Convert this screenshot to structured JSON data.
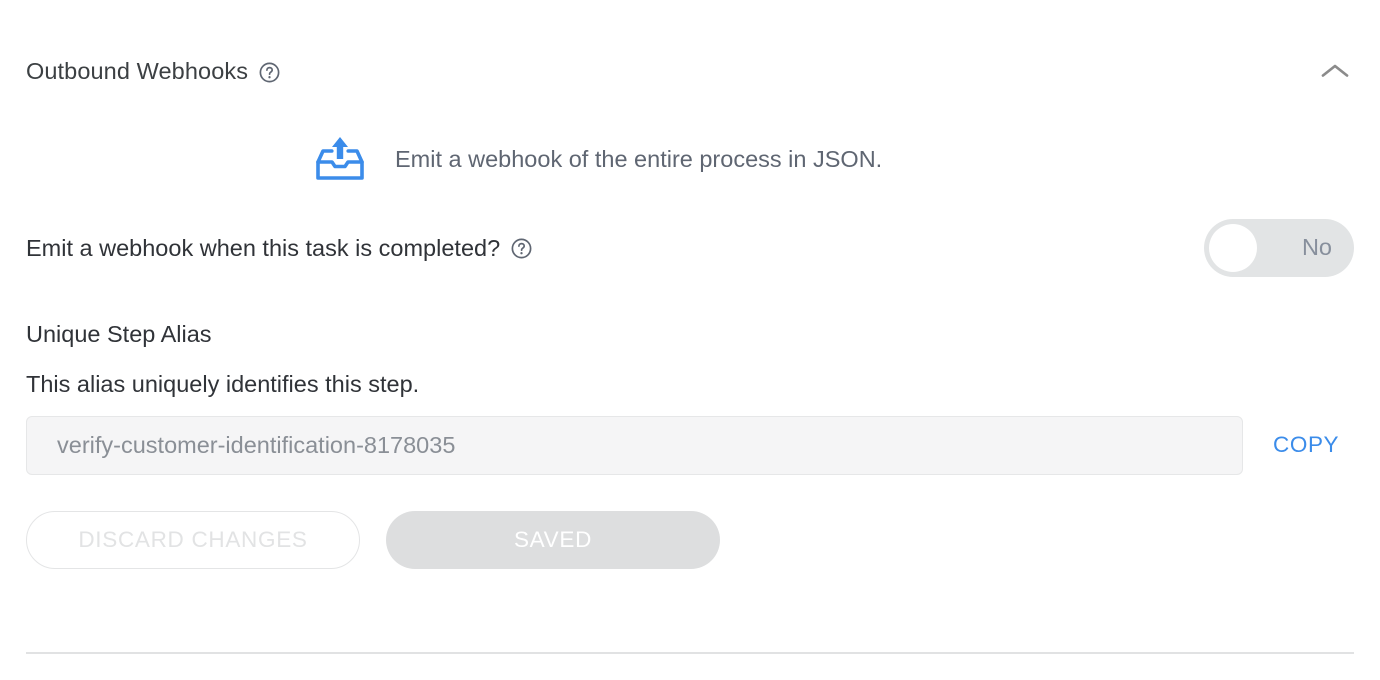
{
  "section": {
    "title": "Outbound Webhooks",
    "help_icon": "help-circle-icon",
    "collapse_icon": "chevron-up-icon"
  },
  "description": {
    "icon": "upload-tray-icon",
    "text": "Emit a webhook of the entire process in JSON."
  },
  "webhook_toggle": {
    "label": "Emit a webhook when this task is completed?",
    "help_icon": "help-circle-icon",
    "state_label": "No",
    "enabled": false
  },
  "alias": {
    "title": "Unique Step Alias",
    "subtitle": "This alias uniquely identifies this step.",
    "value": "verify-customer-identification-8178035",
    "placeholder": "verify-customer-identification-8178035",
    "copy_label": "COPY"
  },
  "actions": {
    "discard_label": "DISCARD CHANGES",
    "save_label": "SAVED",
    "discard_disabled": true,
    "save_disabled": true
  },
  "colors": {
    "accent_blue": "#3b8cea",
    "icon_blue": "#3b8cea",
    "title_text": "#3c4043",
    "muted_text": "#5f6672",
    "toggle_track": "#e2e4e5",
    "saved_button": "#dddedf",
    "divider": "#e1e2e3"
  }
}
